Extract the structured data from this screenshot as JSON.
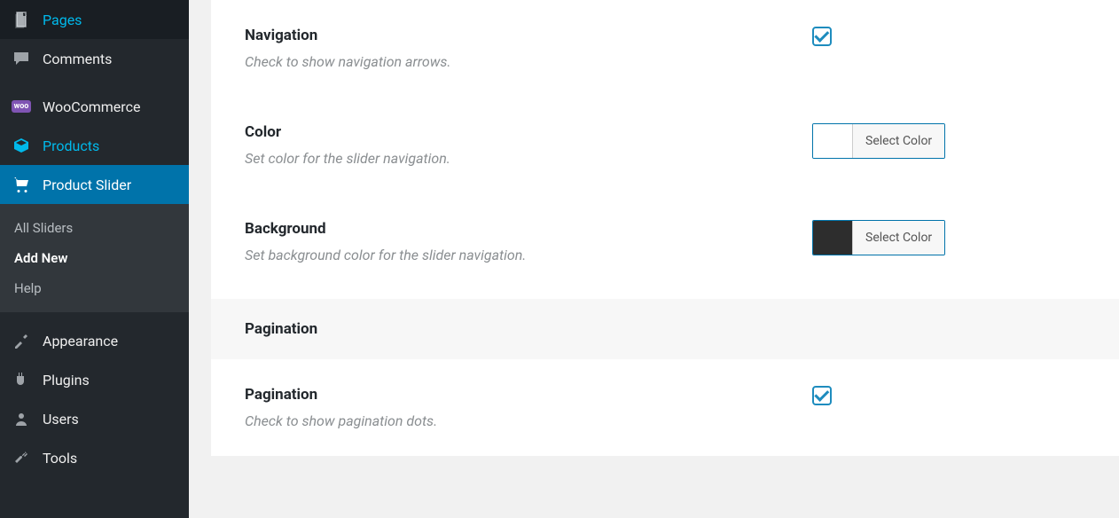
{
  "sidebar": {
    "items": [
      {
        "label": "Pages"
      },
      {
        "label": "Comments"
      },
      {
        "label": "WooCommerce"
      },
      {
        "label": "Products"
      },
      {
        "label": "Product Slider"
      },
      {
        "label": "Appearance"
      },
      {
        "label": "Plugins"
      },
      {
        "label": "Users"
      },
      {
        "label": "Tools"
      }
    ],
    "submenu": [
      {
        "label": "All Sliders"
      },
      {
        "label": "Add New"
      },
      {
        "label": "Help"
      }
    ]
  },
  "settings": {
    "navigation": {
      "title": "Navigation",
      "desc": "Check to show navigation arrows."
    },
    "color": {
      "title": "Color",
      "desc": "Set color for the slider navigation.",
      "button": "Select Color"
    },
    "background": {
      "title": "Background",
      "desc": "Set background color for the slider navigation.",
      "button": "Select Color"
    },
    "pagination_section": "Pagination",
    "pagination": {
      "title": "Pagination",
      "desc": "Check to show pagination dots."
    }
  }
}
